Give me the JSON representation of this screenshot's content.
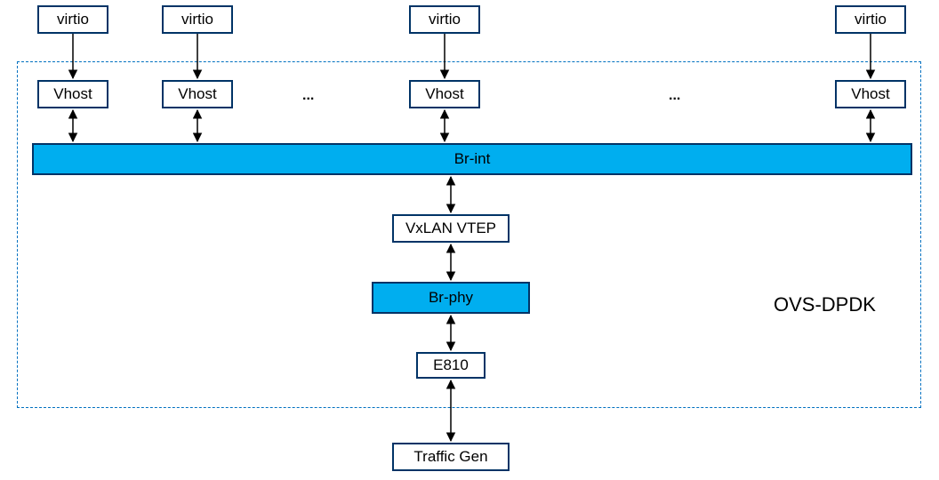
{
  "virtio": {
    "v1": "virtio",
    "v2": "virtio",
    "v3": "virtio",
    "v4": "virtio"
  },
  "vhost": {
    "h1": "Vhost",
    "h2": "Vhost",
    "h3": "Vhost",
    "h4": "Vhost"
  },
  "ellipsis1": "...",
  "ellipsis2": "...",
  "br_int": "Br-int",
  "vxlan": "VxLAN VTEP",
  "br_phy": "Br-phy",
  "nic": "E810",
  "traffic_gen": "Traffic Gen",
  "ovs_label": "OVS-DPDK"
}
